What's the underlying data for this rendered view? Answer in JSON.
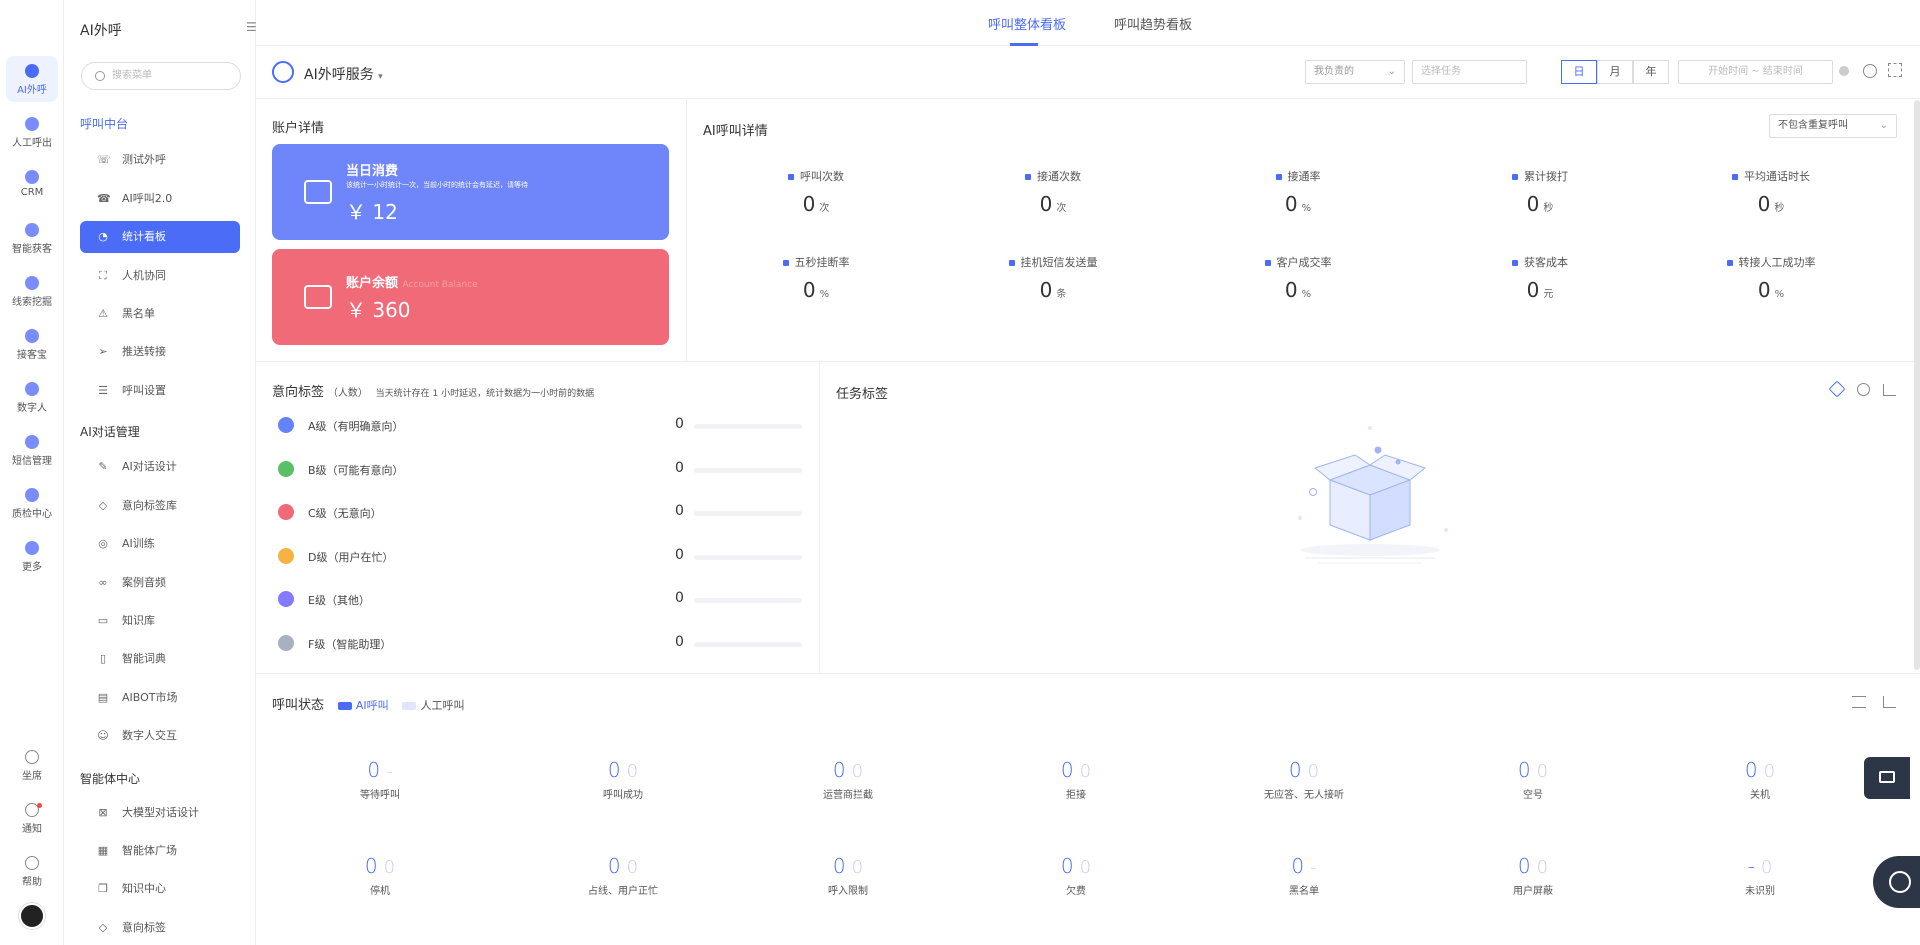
{
  "rail": [
    {
      "label": "AI外呼",
      "icon": "robot-icon",
      "active": true
    },
    {
      "label": "人工呼出",
      "icon": "phone-icon"
    },
    {
      "label": "CRM",
      "icon": "crm-icon"
    },
    {
      "label": "智能获客",
      "icon": "magnet-icon"
    },
    {
      "label": "线索挖掘",
      "icon": "clue-icon"
    },
    {
      "label": "接客宝",
      "icon": "reception-icon"
    },
    {
      "label": "数字人",
      "icon": "digital-human-icon"
    },
    {
      "label": "短信管理",
      "icon": "sms-icon"
    },
    {
      "label": "质检中心",
      "icon": "shield-icon"
    },
    {
      "label": "更多",
      "icon": "more-icon"
    }
  ],
  "rail_bottom": [
    {
      "label": "坐席",
      "icon": "headset-icon"
    },
    {
      "label": "通知",
      "icon": "bell-icon"
    },
    {
      "label": "帮助",
      "icon": "help-icon"
    }
  ],
  "sidebar": {
    "title": "AI外呼",
    "search_placeholder": "搜索菜单",
    "groups": [
      {
        "label": "呼叫中台"
      },
      {
        "label": "AI对话管理"
      },
      {
        "label": "智能体中心"
      }
    ],
    "items": [
      {
        "label": "测试外呼",
        "icon": "☏"
      },
      {
        "label": "AI呼叫2.0",
        "icon": "☎"
      },
      {
        "label": "统计看板",
        "icon": "◔"
      },
      {
        "label": "人机协同",
        "icon": "⛶"
      },
      {
        "label": "黑名单",
        "icon": "⚠"
      },
      {
        "label": "推送转接",
        "icon": "➢"
      },
      {
        "label": "呼叫设置",
        "icon": "☰"
      },
      {
        "label": "AI对话设计",
        "icon": "✎"
      },
      {
        "label": "意向标签库",
        "icon": "◇"
      },
      {
        "label": "AI训练",
        "icon": "◎"
      },
      {
        "label": "案例音频",
        "icon": "∞"
      },
      {
        "label": "知识库",
        "icon": "▭"
      },
      {
        "label": "智能词典",
        "icon": "▯"
      },
      {
        "label": "AIBOT市场",
        "icon": "▤"
      },
      {
        "label": "数字人交互",
        "icon": "☺"
      },
      {
        "label": "大模型对话设计",
        "icon": "⊠"
      },
      {
        "label": "智能体广场",
        "icon": "▦"
      },
      {
        "label": "知识中心",
        "icon": "❒"
      },
      {
        "label": "意向标签",
        "icon": "◇"
      }
    ]
  },
  "tabs": [
    "呼叫整体看板",
    "呼叫趋势看板"
  ],
  "toolbar": {
    "service": "AI外呼服务",
    "owner_select": "我负责的",
    "task_placeholder": "选择任务",
    "periods": [
      "日",
      "月",
      "年"
    ],
    "start_placeholder": "开始时间",
    "range_sep": "~",
    "end_placeholder": "结束时间"
  },
  "account": {
    "title": "账户详情",
    "today_label": "当日消费",
    "today_note": "该统计一小时统计一次，当前小时的统计会有延迟，请等待",
    "today_value": "￥ 12",
    "balance_label": "账户余额",
    "balance_sub": "Account Balance",
    "balance_value": "￥ 360",
    "colors": {
      "today": "#6f86fb",
      "balance": "#f06a77"
    }
  },
  "ai_detail": {
    "title": "AI呼叫详情",
    "filter": "不包含重复呼叫",
    "kpis": [
      {
        "label": "呼叫次数",
        "value": "0",
        "unit": "次"
      },
      {
        "label": "接通次数",
        "value": "0",
        "unit": "次"
      },
      {
        "label": "接通率",
        "value": "0",
        "unit": "%"
      },
      {
        "label": "累计拨打",
        "value": "0",
        "unit": "秒"
      },
      {
        "label": "平均通话时长",
        "value": "0",
        "unit": "秒"
      },
      {
        "label": "五秒挂断率",
        "value": "0",
        "unit": "%"
      },
      {
        "label": "挂机短信发送量",
        "value": "0",
        "unit": "条"
      },
      {
        "label": "客户成交率",
        "value": "0",
        "unit": "%"
      },
      {
        "label": "获客成本",
        "value": "0",
        "unit": "元"
      },
      {
        "label": "转接人工成功率",
        "value": "0",
        "unit": "%"
      }
    ]
  },
  "intent": {
    "title": "意向标签",
    "unit": "（人数）",
    "note": "当天统计存在 1 小时延迟，统计数据为一小时前的数据",
    "rows": [
      {
        "label": "A级（有明确意向）",
        "value": "0",
        "color": "#4a6cf7"
      },
      {
        "label": "B级（可能有意向）",
        "value": "0",
        "color": "#3bb54a"
      },
      {
        "label": "C级（无意向）",
        "value": "0",
        "color": "#f0505f"
      },
      {
        "label": "D级（用户在忙）",
        "value": "0",
        "color": "#f5a623"
      },
      {
        "label": "E级（其他）",
        "value": "0",
        "color": "#6c63ff"
      },
      {
        "label": "F级（智能助理）",
        "value": "0",
        "color": "#9aa3b5"
      }
    ]
  },
  "task_tag": {
    "title": "任务标签"
  },
  "call_status": {
    "title": "呼叫状态",
    "legend": [
      "AI呼叫",
      "人工呼叫"
    ],
    "items": [
      {
        "label": "等待呼叫",
        "a": "0",
        "b": "-"
      },
      {
        "label": "呼叫成功",
        "a": "0",
        "b": "0"
      },
      {
        "label": "运营商拦截",
        "a": "0",
        "b": "0"
      },
      {
        "label": "拒接",
        "a": "0",
        "b": "0"
      },
      {
        "label": "无应答、无人接听",
        "a": "0",
        "b": "0"
      },
      {
        "label": "空号",
        "a": "0",
        "b": "0"
      },
      {
        "label": "关机",
        "a": "0",
        "b": "0"
      },
      {
        "label": "停机",
        "a": "0",
        "b": "0"
      },
      {
        "label": "占线、用户正忙",
        "a": "0",
        "b": "0"
      },
      {
        "label": "呼入限制",
        "a": "0",
        "b": "0"
      },
      {
        "label": "欠费",
        "a": "0",
        "b": "0"
      },
      {
        "label": "黑名单",
        "a": "0",
        "b": "-"
      },
      {
        "label": "用户屏蔽",
        "a": "0",
        "b": "0"
      },
      {
        "label": "未识别",
        "a": "-",
        "b": "0"
      }
    ]
  }
}
